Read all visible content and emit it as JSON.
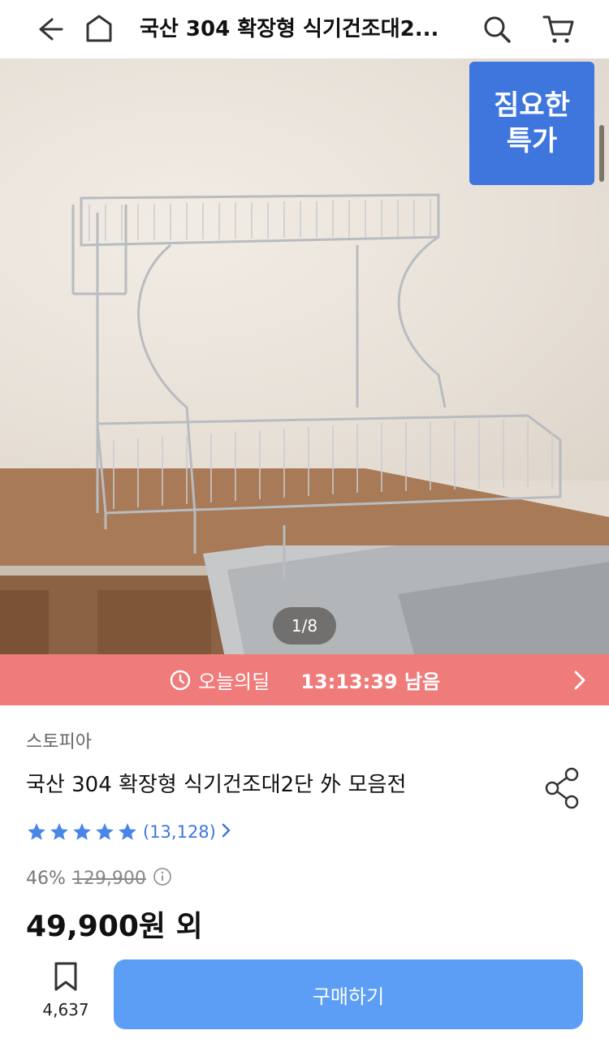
{
  "header": {
    "title": "국산 304 확장형 식기건조대2...",
    "back_icon": "arrow-left-icon",
    "home_icon": "home-icon",
    "search_icon": "search-icon",
    "cart_icon": "cart-icon"
  },
  "gallery": {
    "badge_line1": "짐요한",
    "badge_line2": "특가",
    "counter": "1/8",
    "image_subject": "stainless-dish-rack-photo"
  },
  "deal": {
    "label": "오늘의딜",
    "remaining": "13:13:39 남음",
    "icon": "clock-icon"
  },
  "product": {
    "seller": "스토피아",
    "name": "국산 304 확장형 식기건조대2단 外 모음전",
    "rating_stars": 5,
    "review_count": "(13,128)",
    "discount": "46%",
    "original_price": "129,900",
    "price": "49,900원 외"
  },
  "bottom_bar": {
    "bookmark_count": "4,637",
    "buy_label": "구매하기"
  },
  "colors": {
    "accent": "#3e76de",
    "deal_bg": "#ef7c7a",
    "buy_bg": "#5c9ef5",
    "star": "#4a86e8"
  }
}
